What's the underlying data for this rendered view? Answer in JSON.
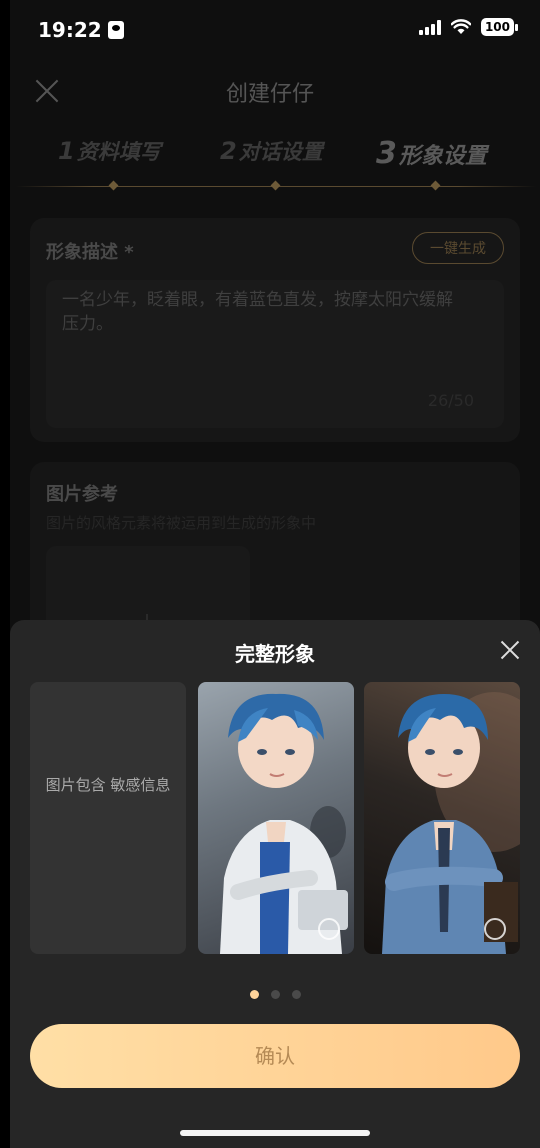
{
  "status_bar": {
    "time": "19:22",
    "battery": "100"
  },
  "header": {
    "title": "创建仔仔"
  },
  "steps": [
    {
      "num": "1",
      "label": "资料填写"
    },
    {
      "num": "2",
      "label": "对话设置"
    },
    {
      "num": "3",
      "label": "形象设置"
    }
  ],
  "appearance": {
    "label": "形象描述 *",
    "generate_button": "一键生成",
    "description": "一名少年，眨着眼，有着蓝色直发，按摩太阳穴缓解压力。",
    "char_count": "26/50"
  },
  "reference": {
    "label": "图片参考",
    "hint": "图片的风格元素将被运用到生成的形象中"
  },
  "sheet": {
    "title": "完整形象",
    "sensitive_message": "图片包含 敏感信息",
    "confirm_button": "确认",
    "pager": {
      "total": 3,
      "active": 1
    }
  },
  "colors": {
    "accent": "#ffd39a",
    "confirm_gradient": [
      "#ffdfa6",
      "#ffc98a"
    ]
  }
}
